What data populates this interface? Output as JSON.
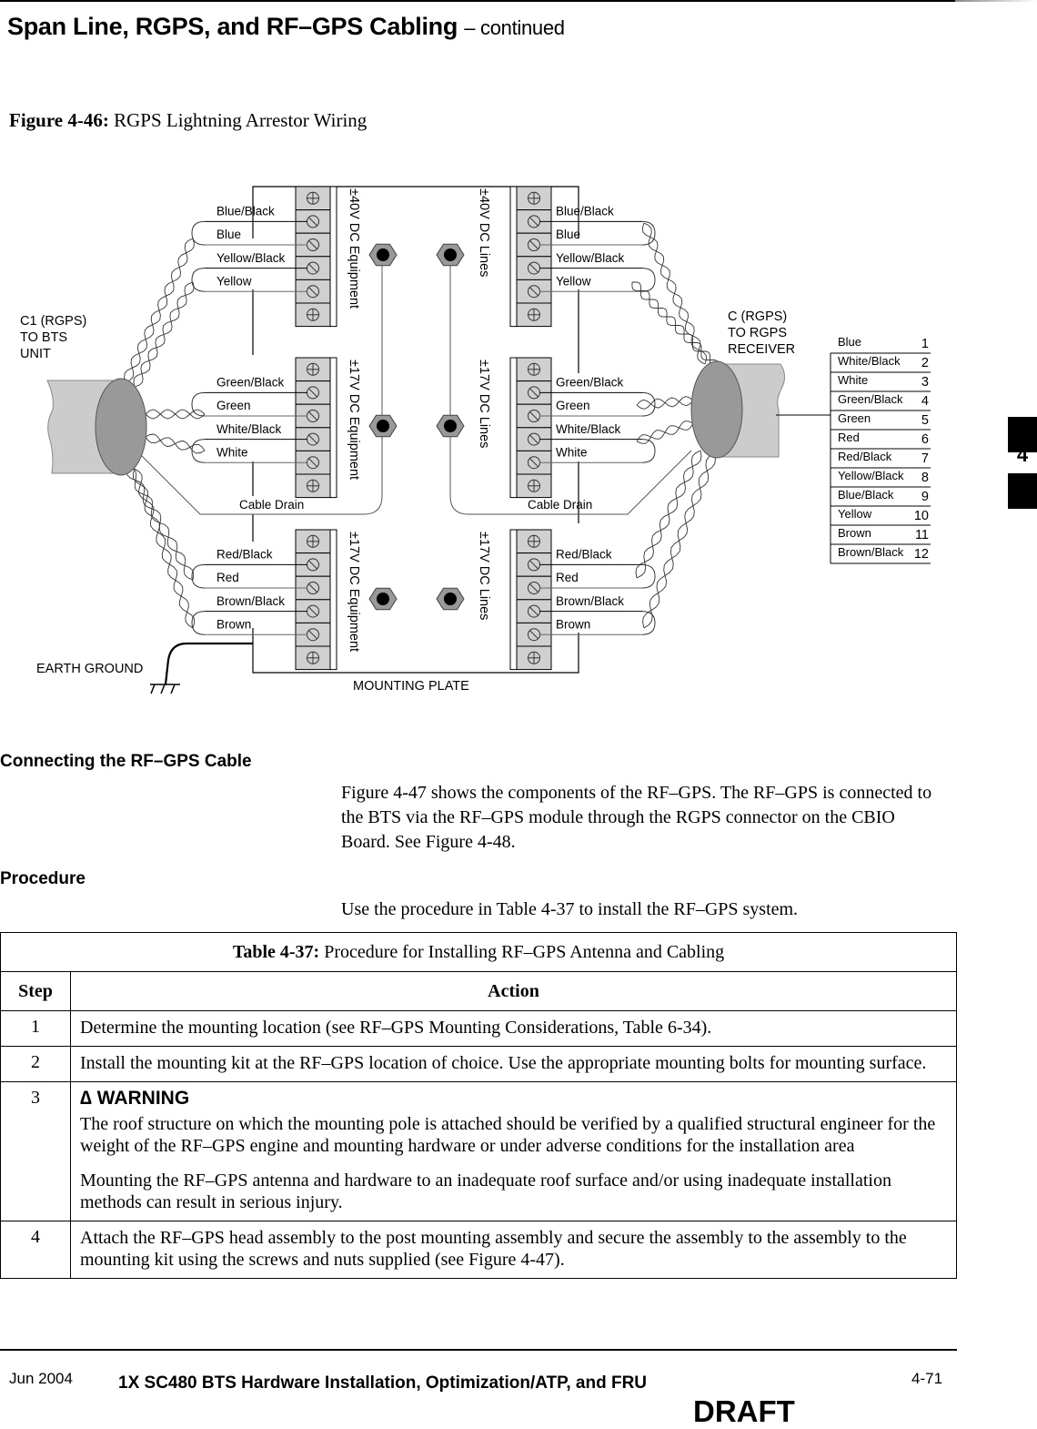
{
  "header": {
    "title": "Span Line, RGPS, and RF–GPS Cabling",
    "continued": "– continued"
  },
  "figure": {
    "number": "Figure 4-46:",
    "title": "RGPS Lightning Arrestor Wiring",
    "left_connector": [
      "C1 (RGPS)",
      "TO BTS",
      "UNIT"
    ],
    "right_connector": [
      "C (RGPS)",
      "TO RGPS",
      "RECEIVER"
    ],
    "earth_ground": "EARTH GROUND",
    "mounting_plate": "MOUNTING PLATE",
    "cable_drain": "Cable Drain",
    "blocks": [
      {
        "label": "±40V DC Equipment",
        "wires": [
          "Blue/Black",
          "Blue",
          "Yellow/Black",
          "Yellow"
        ]
      },
      {
        "label": "±40V DC Lines",
        "wires": [
          "Blue/Black",
          "Blue",
          "Yellow/Black",
          "Yellow"
        ]
      },
      {
        "label": "±17V DC Equipment",
        "wires": [
          "Green/Black",
          "Green",
          "White/Black",
          "White"
        ]
      },
      {
        "label": "±17V DC Lines",
        "wires": [
          "Green/Black",
          "Green",
          "White/Black",
          "White"
        ]
      },
      {
        "label": "±17V DC Equipment",
        "wires": [
          "Red/Black",
          "Red",
          "Brown/Black",
          "Brown"
        ]
      },
      {
        "label": "±17V DC Lines",
        "wires": [
          "Red/Black",
          "Red",
          "Brown/Black",
          "Brown"
        ]
      }
    ],
    "pinout": [
      {
        "color": "Blue",
        "pin": "1"
      },
      {
        "color": "White/Black",
        "pin": "2"
      },
      {
        "color": "White",
        "pin": "3"
      },
      {
        "color": "Green/Black",
        "pin": "4"
      },
      {
        "color": "Green",
        "pin": "5"
      },
      {
        "color": "Red",
        "pin": "6"
      },
      {
        "color": "Red/Black",
        "pin": "7"
      },
      {
        "color": "Yellow/Black",
        "pin": "8"
      },
      {
        "color": "Blue/Black",
        "pin": "9"
      },
      {
        "color": "Yellow",
        "pin": "10"
      },
      {
        "color": "Brown",
        "pin": "11"
      },
      {
        "color": "Brown/Black",
        "pin": "12"
      }
    ]
  },
  "sections": {
    "connecting": {
      "heading": "Connecting the RF–GPS Cable",
      "body": "Figure 4-47 shows the components of the RF–GPS. The RF–GPS is connected to the BTS via the RF–GPS module through the RGPS connector on the CBIO Board. See Figure 4-48."
    },
    "procedure": {
      "heading": "Procedure",
      "body": "Use the procedure in Table 4-37 to install the RF–GPS system."
    }
  },
  "table": {
    "number": "Table 4-37:",
    "title": "Procedure for Installing RF–GPS Antenna and Cabling",
    "col_step": "Step",
    "col_action": "Action",
    "rows": [
      {
        "step": "1",
        "action": "Determine the mounting location (see RF–GPS Mounting Considerations, Table 6-34)."
      },
      {
        "step": "2",
        "action": "Install the mounting kit at the RF–GPS location of choice. Use the appropriate mounting bolts for mounting surface."
      },
      {
        "step": "3",
        "warning_title": "∆ WARNING",
        "warning_p1": "The roof structure on which the mounting pole is attached should be verified by a qualified structural engineer for the weight of the RF–GPS engine and mounting hardware or under adverse conditions for the installation area",
        "warning_p2": "Mounting the RF–GPS antenna and hardware to an inadequate roof surface and/or using inadequate installation methods can result in serious injury."
      },
      {
        "step": "4",
        "action": "Attach the RF–GPS head assembly to the post mounting assembly and secure the assembly to the assembly to the mounting kit using the screws and nuts supplied (see Figure 4-47)."
      }
    ]
  },
  "footer": {
    "date": "Jun 2004",
    "title": "1X SC480 BTS Hardware Installation, Optimization/ATP, and FRU",
    "page": "4-71",
    "draft": "DRAFT"
  },
  "chapter_tab": "4"
}
